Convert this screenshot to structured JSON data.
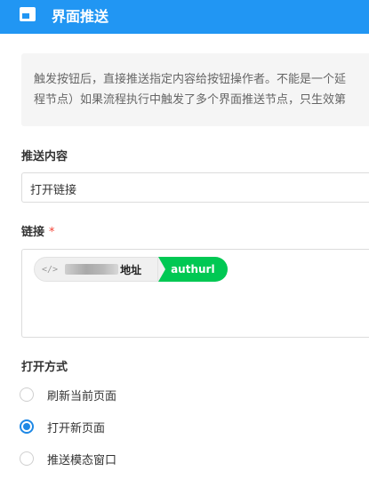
{
  "header": {
    "title": "界面推送",
    "icon": "window-icon"
  },
  "description": {
    "line1": "触发按钮后，直接推送指定内容给按钮操作者。不能是一个延",
    "line2": "程节点）如果流程执行中触发了多个界面推送节点，只生效第"
  },
  "content": {
    "label": "推送内容",
    "value": "打开链接"
  },
  "link": {
    "label": "链接",
    "required_mark": "*",
    "chip": {
      "code_icon": "</>",
      "field_label": "地址",
      "node_name": "authurl"
    }
  },
  "open_mode": {
    "label": "打开方式",
    "options": [
      {
        "label": "刷新当前页面",
        "selected": false
      },
      {
        "label": "打开新页面",
        "selected": true
      },
      {
        "label": "推送模态窗口",
        "selected": false
      }
    ]
  },
  "colors": {
    "header": "#2196f3",
    "accent": "#1e88e5",
    "chip_green": "#00c853",
    "required": "#f44336"
  }
}
